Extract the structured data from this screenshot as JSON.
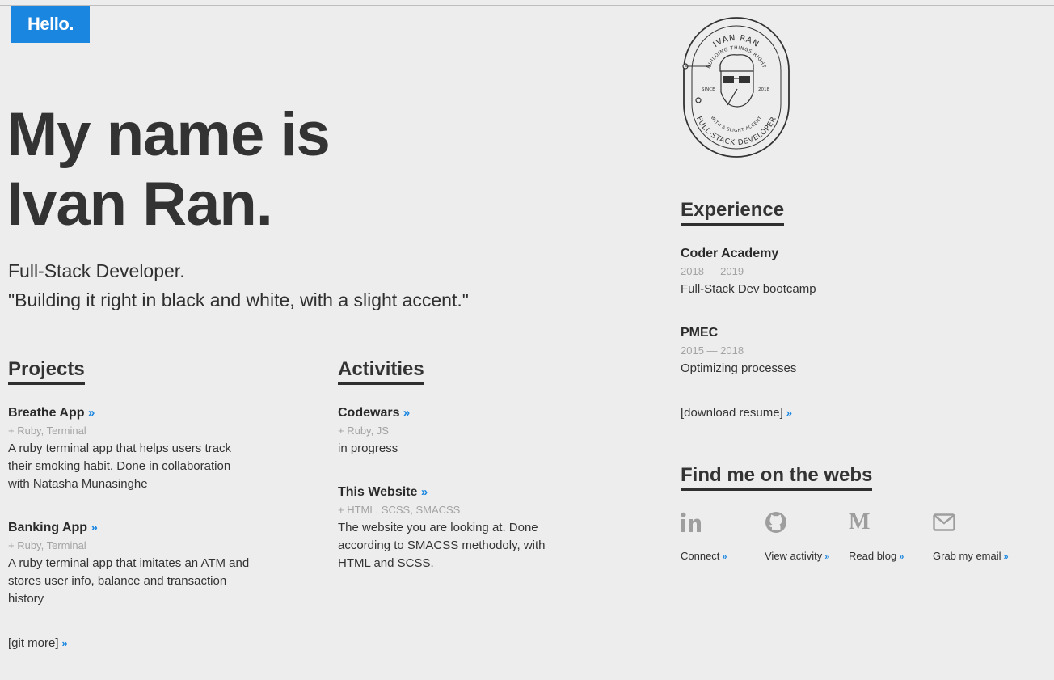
{
  "hello": "Hello.",
  "hero": {
    "line1": "My name is",
    "line2": "Ivan Ran."
  },
  "tagline": {
    "role": "Full-Stack Developer.",
    "quote": "\"Building it right in black and white, with a slight accent.\""
  },
  "logo": {
    "name": "IVAN RAN",
    "motto_top": "BUILDING THINGS RIGHT",
    "since": "SINCE",
    "year": "2018",
    "motto_bottom": "WITH A SLIGHT ACCENT",
    "title": "FULL-STACK DEVELOPER"
  },
  "arrow": "»",
  "projects": {
    "title": "Projects",
    "items": [
      {
        "name": "Breathe App",
        "tags": "+ Ruby, Terminal",
        "desc": "A ruby terminal app that helps users track their smoking habit. Done in collaboration with Natasha Munasinghe"
      },
      {
        "name": "Banking App",
        "tags": "+ Ruby, Terminal",
        "desc": "A ruby terminal app that imitates an ATM and stores user info, balance and transaction history"
      }
    ],
    "more": "[git more]"
  },
  "activities": {
    "title": "Activities",
    "items": [
      {
        "name": "Codewars",
        "tags": "+ Ruby, JS",
        "desc": "in progress"
      },
      {
        "name": "This Website",
        "tags": "+ HTML, SCSS, SMACSS",
        "desc": "The website you are looking at. Done according to SMACSS methodoly, with HTML and SCSS."
      }
    ]
  },
  "experience": {
    "title": "Experience",
    "items": [
      {
        "company": "Coder Academy",
        "years": "2018 — 2019",
        "role": "Full-Stack Dev bootcamp"
      },
      {
        "company": "PMEC",
        "years": "2015 — 2018",
        "role": "Optimizing processes"
      }
    ],
    "resume": "[download resume]"
  },
  "webs": {
    "title": "Find me on the webs",
    "items": [
      {
        "icon": "linkedin-icon",
        "label": "Connect"
      },
      {
        "icon": "github-icon",
        "label": "View activity"
      },
      {
        "icon": "medium-icon",
        "label": "Read blog"
      },
      {
        "icon": "mail-icon",
        "label": "Grab my email"
      }
    ]
  },
  "colors": {
    "accent": "#1a86e0",
    "background": "#ededed",
    "text": "#2f2f2f",
    "muted": "#a3a3a3"
  }
}
